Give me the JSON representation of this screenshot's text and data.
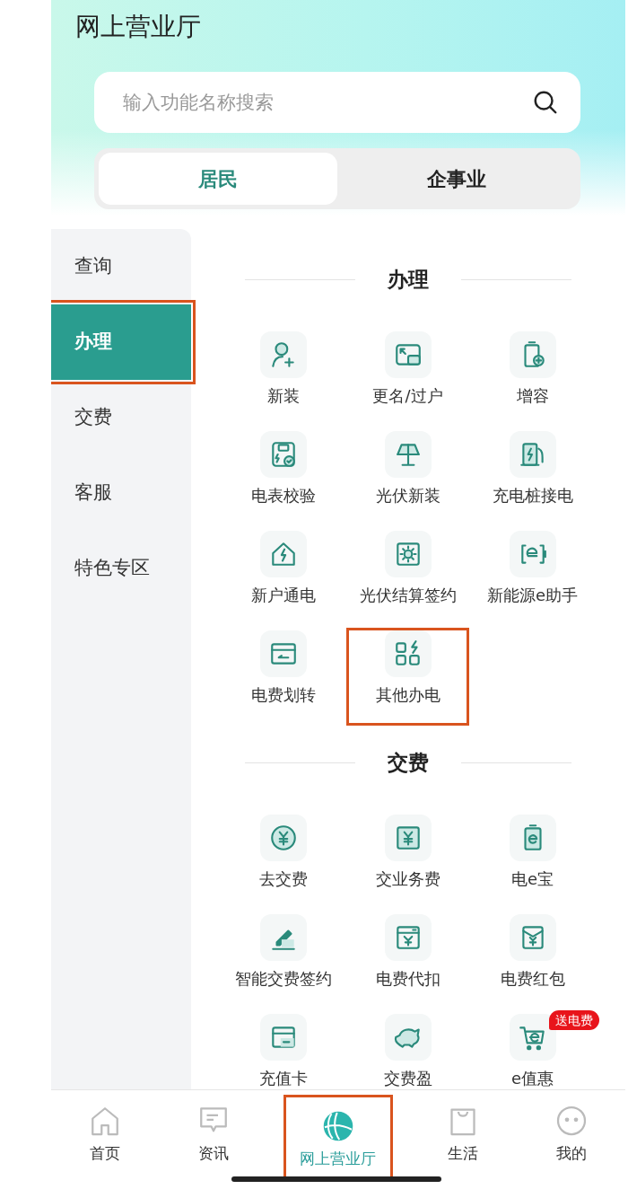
{
  "title": "网上营业厅",
  "search": {
    "placeholder": "输入功能名称搜索"
  },
  "segments": [
    {
      "label": "居民",
      "selected": true
    },
    {
      "label": "企事业",
      "selected": false
    }
  ],
  "sidebar": {
    "items": [
      {
        "label": "查询",
        "selected": false,
        "highlighted": false
      },
      {
        "label": "办理",
        "selected": true,
        "highlighted": true
      },
      {
        "label": "交费",
        "selected": false,
        "highlighted": false
      },
      {
        "label": "客服",
        "selected": false,
        "highlighted": false
      },
      {
        "label": "特色专区",
        "selected": false,
        "highlighted": false
      }
    ]
  },
  "sections": [
    {
      "title": "办理",
      "items": [
        {
          "label": "新装",
          "highlighted": false
        },
        {
          "label": "更名/过户",
          "highlighted": false
        },
        {
          "label": "增容",
          "highlighted": false
        },
        {
          "label": "电表校验",
          "highlighted": false
        },
        {
          "label": "光伏新装",
          "highlighted": false
        },
        {
          "label": "充电桩接电",
          "highlighted": false
        },
        {
          "label": "新户通电",
          "highlighted": false
        },
        {
          "label": "光伏结算签约",
          "highlighted": false
        },
        {
          "label": "新能源e助手",
          "highlighted": false
        },
        {
          "label": "电费划转",
          "highlighted": false
        },
        {
          "label": "其他办电",
          "highlighted": true
        }
      ]
    },
    {
      "title": "交费",
      "items": [
        {
          "label": "去交费",
          "highlighted": false
        },
        {
          "label": "交业务费",
          "highlighted": false
        },
        {
          "label": "电e宝",
          "highlighted": false
        },
        {
          "label": "智能交费签约",
          "highlighted": false
        },
        {
          "label": "电费代扣",
          "highlighted": false
        },
        {
          "label": "电费红包",
          "highlighted": false
        },
        {
          "label": "充值卡",
          "highlighted": false
        },
        {
          "label": "交费盈",
          "highlighted": false
        },
        {
          "label": "e值惠",
          "highlighted": false,
          "badge": "送电费"
        }
      ]
    }
  ],
  "tab_bar": {
    "items": [
      {
        "label": "首页",
        "selected": false,
        "highlighted": false
      },
      {
        "label": "资讯",
        "selected": false,
        "highlighted": false
      },
      {
        "label": "网上营业厅",
        "selected": true,
        "highlighted": true
      },
      {
        "label": "生活",
        "selected": false,
        "highlighted": false
      },
      {
        "label": "我的",
        "selected": false,
        "highlighted": false
      }
    ]
  }
}
